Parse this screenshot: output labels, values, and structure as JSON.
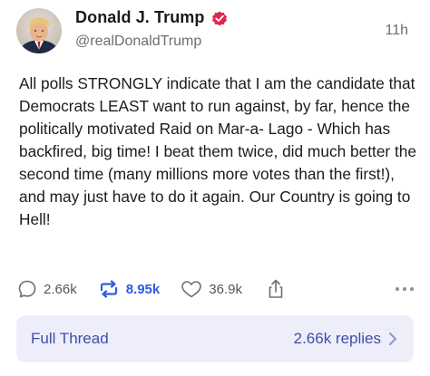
{
  "author": {
    "display_name": "Donald J. Trump",
    "handle": "@realDonaldTrump",
    "verified": true,
    "verified_color": "#e0264f",
    "avatar_icon": "profile-photo"
  },
  "post": {
    "time_ago": "11h",
    "text": "All polls STRONGLY indicate that I am the candidate that Democrats LEAST want to run against, by far, hence the politically motivated Raid on Mar-a- Lago - Which has backfired, big time! I beat them twice, did much better the second time (many millions more votes than the first!), and may just have to do it again. Our Country is going to Hell!"
  },
  "actions": {
    "replies_count": "2.66k",
    "reposts_count": "8.95k",
    "likes_count": "36.9k",
    "repost_color": "#2d5de0",
    "icons": [
      "comment-icon",
      "repost-icon",
      "heart-icon",
      "share-icon",
      "more-icon"
    ]
  },
  "thread": {
    "label": "Full Thread",
    "replies_label": "2.66k replies",
    "background": "#eeeefb",
    "text_color": "#3e4fa8"
  }
}
